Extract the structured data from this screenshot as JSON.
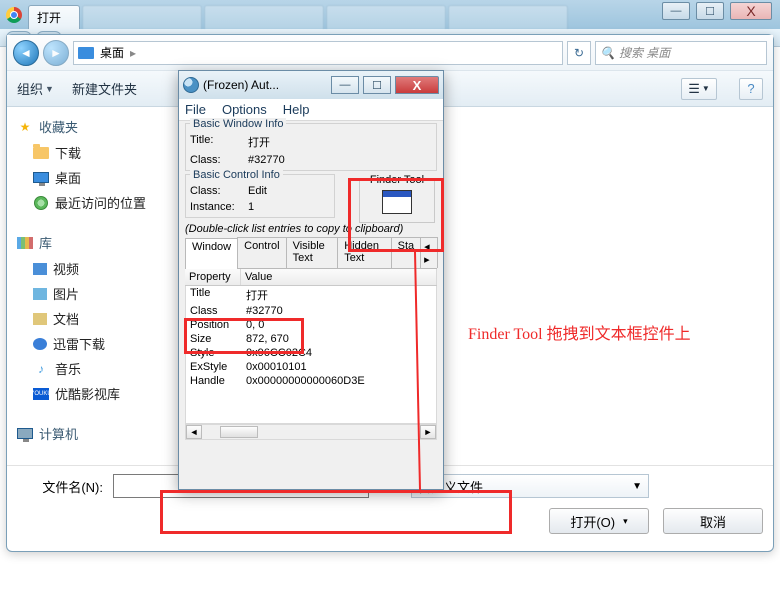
{
  "chrome": {
    "tab_title": "打开",
    "close_glyph": "X",
    "min_glyph": "—",
    "max_glyph": "☐"
  },
  "filedlg": {
    "breadcrumb_loc": "桌面",
    "breadcrumb_sep": "▸",
    "search_placeholder": "搜索 桌面",
    "toolbar": {
      "organize": "组织",
      "newfolder": "新建文件夹",
      "dd_tri": "▼"
    },
    "sidebar": {
      "fav_head": "收藏夹",
      "fav_items": [
        "下载",
        "桌面",
        "最近访问的位置"
      ],
      "lib_head": "库",
      "lib_items": [
        "视频",
        "图片",
        "文档",
        "迅雷下载",
        "音乐",
        "优酷影视库"
      ],
      "comp_head": "计算机"
    },
    "bottom": {
      "filename_label": "文件名(N):",
      "filetype_value": "自定义文件",
      "open_btn": "打开(O)",
      "cancel_btn": "取消",
      "dd_tri": "▼",
      "split_tri": "▾"
    }
  },
  "au3": {
    "title": "(Frozen) Aut...",
    "menu": [
      "File",
      "Options",
      "Help"
    ],
    "basic_window": {
      "group": "Basic Window Info",
      "title_k": "Title:",
      "title_v": "打开",
      "class_k": "Class:",
      "class_v": "#32770"
    },
    "basic_control": {
      "group": "Basic Control Info",
      "class_k": "Class:",
      "class_v": "Edit",
      "inst_k": "Instance:",
      "inst_v": "1"
    },
    "finder_label": "Finder Tool",
    "note": "(Double-click list entries to copy to clipboard)",
    "tabs": [
      "Window",
      "Control",
      "Visible Text",
      "Hidden Text",
      "Sta"
    ],
    "tabs_more": "◂ ▸",
    "list_header": {
      "prop": "Property",
      "val": "Value"
    },
    "rows": [
      {
        "p": "Title",
        "v": "打开"
      },
      {
        "p": "Class",
        "v": "#32770"
      },
      {
        "p": "Position",
        "v": "0, 0"
      },
      {
        "p": "Size",
        "v": "872, 670"
      },
      {
        "p": "Style",
        "v": "0x96CC02C4"
      },
      {
        "p": "ExStyle",
        "v": "0x00010101"
      },
      {
        "p": "Handle",
        "v": "0x00000000000060D3E"
      }
    ],
    "win": {
      "min": "—",
      "max": "☐",
      "close": "X"
    }
  },
  "annot": {
    "text": "Finder Tool 拖拽到文本框控件上"
  }
}
